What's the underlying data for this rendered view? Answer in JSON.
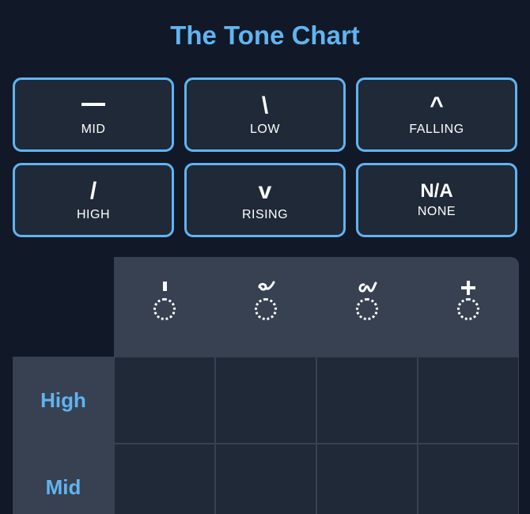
{
  "title": "The Tone Chart",
  "tones": [
    {
      "symbol": "",
      "name": "MID",
      "icon": "dash-icon"
    },
    {
      "symbol": "\\",
      "name": "LOW",
      "icon": "backslash-icon"
    },
    {
      "symbol": "^",
      "name": "FALLING",
      "icon": "caret-icon"
    },
    {
      "symbol": "/",
      "name": "HIGH",
      "icon": "slash-icon"
    },
    {
      "symbol": "v",
      "name": "RISING",
      "icon": "v-icon"
    },
    {
      "symbol": "N/A",
      "name": "NONE",
      "icon": "na-icon"
    }
  ],
  "table": {
    "columns": [
      {
        "mark": "'",
        "icon": "mai-ek-mark-icon"
      },
      {
        "mark": "้",
        "icon": "mai-tho-mark-icon"
      },
      {
        "mark": "๊",
        "icon": "mai-tri-mark-icon"
      },
      {
        "mark": "+",
        "icon": "mai-chattawa-mark-icon"
      }
    ],
    "rows": [
      {
        "label": "High"
      },
      {
        "label": "Mid"
      }
    ]
  },
  "colors": {
    "background": "#111827",
    "accent": "#60b4f0",
    "button_bg": "#1f2937",
    "header_bg": "#374151"
  }
}
